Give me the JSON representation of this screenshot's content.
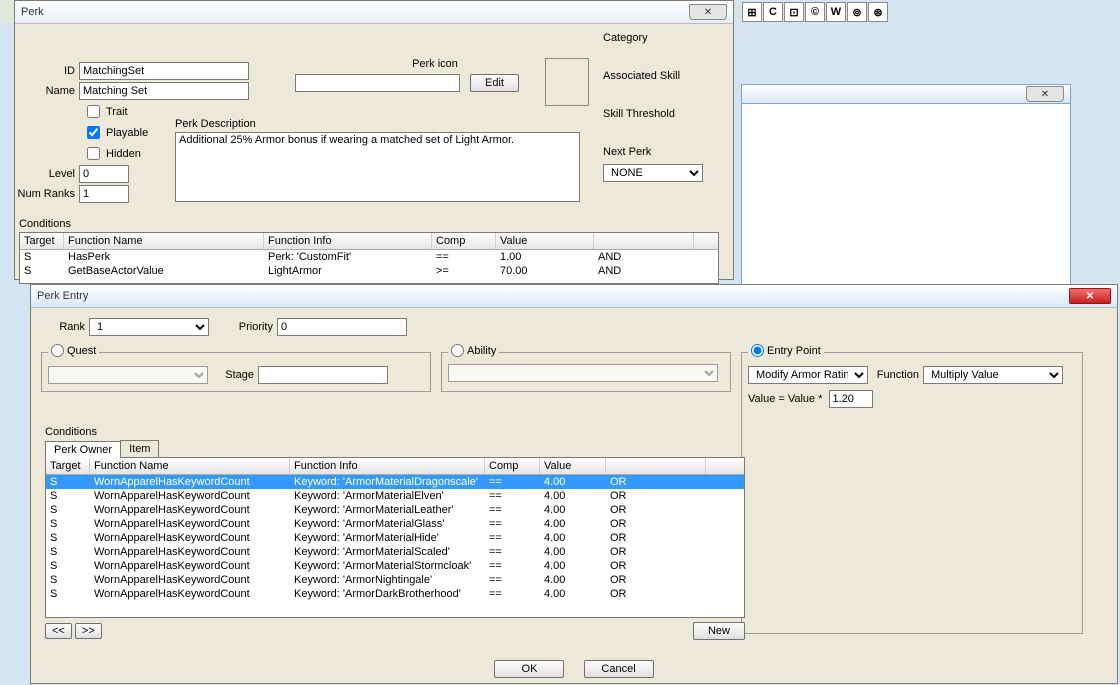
{
  "toolbar_icons": [
    "⊞",
    "C",
    "⊡",
    "©",
    "W",
    "⊚",
    "⊛"
  ],
  "perk_window": {
    "title": "Perk",
    "id_label": "ID",
    "id_value": "MatchingSet",
    "name_label": "Name",
    "name_value": "Matching Set",
    "trait_label": "Trait",
    "playable_label": "Playable",
    "hidden_label": "Hidden",
    "level_label": "Level",
    "level_value": "0",
    "numranks_label": "Num Ranks",
    "numranks_value": "1",
    "perkicon_label": "Perk icon",
    "edit_label": "Edit",
    "desc_label": "Perk Description",
    "desc_value": "Additional 25% Armor bonus if wearing a matched set of Light Armor.",
    "category_label": "Category",
    "assoc_skill_label": "Associated Skill",
    "skill_thresh_label": "Skill Threshold",
    "next_perk_label": "Next Perk",
    "next_perk_value": "NONE",
    "conditions_label": "Conditions",
    "cond_headers": [
      "Target",
      "Function Name",
      "Function Info",
      "Comp",
      "Value",
      ""
    ],
    "cond_rows": [
      {
        "t": "S",
        "fn": "HasPerk",
        "fi": "Perk: 'CustomFit'",
        "c": "==",
        "v": "1.00",
        "l": "AND"
      },
      {
        "t": "S",
        "fn": "GetBaseActorValue",
        "fi": "LightArmor",
        "c": ">=",
        "v": "70.00",
        "l": "AND"
      }
    ]
  },
  "entry_window": {
    "title": "Perk Entry",
    "rank_label": "Rank",
    "rank_value": "1",
    "priority_label": "Priority",
    "priority_value": "0",
    "quest_label": "Quest",
    "stage_label": "Stage",
    "ability_label": "Ability",
    "entrypoint_label": "Entry Point",
    "entrypoint_value": "Modify Armor Rating",
    "function_label": "Function",
    "function_value": "Multiply Value",
    "value_label": "Value = Value *",
    "value_value": "1.20",
    "conditions_label": "Conditions",
    "tab_owner": "Perk Owner",
    "tab_item": "Item",
    "headers": [
      "Target",
      "Function Name",
      "Function Info",
      "Comp",
      "Value",
      ""
    ],
    "rows": [
      {
        "t": "S",
        "fn": "WornApparelHasKeywordCount",
        "fi": "Keyword: 'ArmorMaterialDragonscale'",
        "c": "==",
        "v": "4.00",
        "l": "OR",
        "sel": true
      },
      {
        "t": "S",
        "fn": "WornApparelHasKeywordCount",
        "fi": "Keyword: 'ArmorMaterialElven'",
        "c": "==",
        "v": "4.00",
        "l": "OR"
      },
      {
        "t": "S",
        "fn": "WornApparelHasKeywordCount",
        "fi": "Keyword: 'ArmorMaterialLeather'",
        "c": "==",
        "v": "4.00",
        "l": "OR"
      },
      {
        "t": "S",
        "fn": "WornApparelHasKeywordCount",
        "fi": "Keyword: 'ArmorMaterialGlass'",
        "c": "==",
        "v": "4.00",
        "l": "OR"
      },
      {
        "t": "S",
        "fn": "WornApparelHasKeywordCount",
        "fi": "Keyword: 'ArmorMaterialHide'",
        "c": "==",
        "v": "4.00",
        "l": "OR"
      },
      {
        "t": "S",
        "fn": "WornApparelHasKeywordCount",
        "fi": "Keyword: 'ArmorMaterialScaled'",
        "c": "==",
        "v": "4.00",
        "l": "OR"
      },
      {
        "t": "S",
        "fn": "WornApparelHasKeywordCount",
        "fi": "Keyword: 'ArmorMaterialStormcloak'",
        "c": "==",
        "v": "4.00",
        "l": "OR"
      },
      {
        "t": "S",
        "fn": "WornApparelHasKeywordCount",
        "fi": "Keyword: 'ArmorNightingale'",
        "c": "==",
        "v": "4.00",
        "l": "OR"
      },
      {
        "t": "S",
        "fn": "WornApparelHasKeywordCount",
        "fi": "Keyword: 'ArmorDarkBrotherhood'",
        "c": "==",
        "v": "4.00",
        "l": "OR"
      }
    ],
    "prev_label": "<<",
    "next_label": ">>",
    "new_label": "New",
    "ok_label": "OK",
    "cancel_label": "Cancel"
  }
}
